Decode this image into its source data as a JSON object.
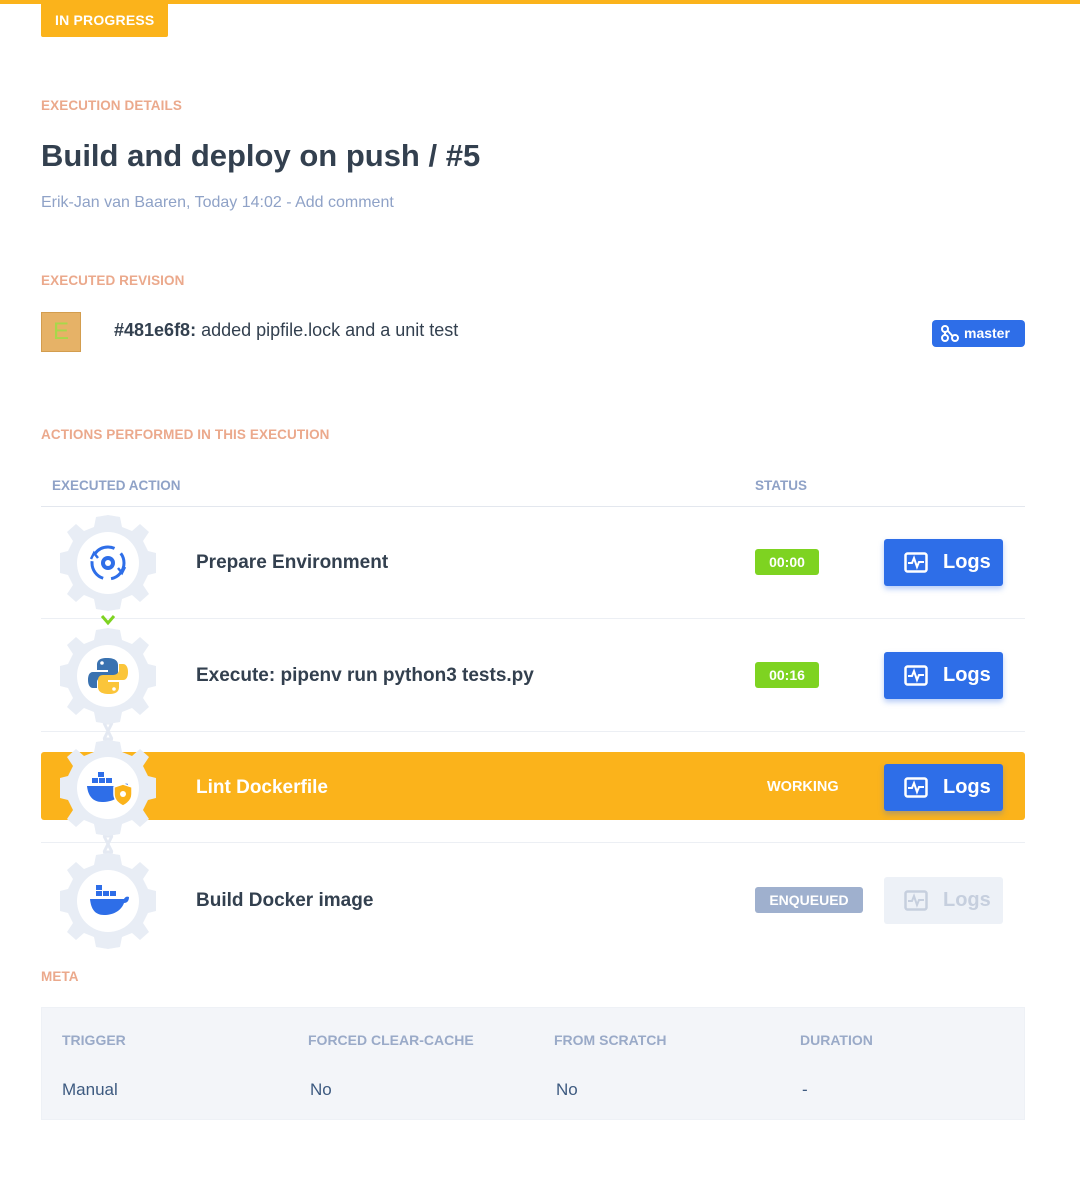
{
  "status_pill": "IN PROGRESS",
  "execution": {
    "section_label": "EXECUTION DETAILS",
    "title": "Build and deploy on push / #5",
    "author_time": "Erik-Jan van Baaren, Today 14:02 - ",
    "add_comment": "Add comment"
  },
  "revision": {
    "section_label": "EXECUTED REVISION",
    "avatar_letter": "E",
    "hash": "#481e6f8:",
    "message": " added pipfile.lock and a unit test",
    "branch": "master"
  },
  "actions": {
    "section_label": "ACTIONS PERFORMED IN THIS EXECUTION",
    "col_action": "EXECUTED ACTION",
    "col_status": "STATUS",
    "logs_label": "Logs",
    "rows": [
      {
        "name": "Prepare Environment",
        "status": "00:00",
        "icon": "gear-refresh-icon"
      },
      {
        "name": "Execute: pipenv run python3 tests.py",
        "status": "00:16",
        "icon": "python-icon"
      },
      {
        "name": "Lint Dockerfile",
        "status": "WORKING",
        "icon": "docker-shield-icon"
      },
      {
        "name": "Build Docker image",
        "status": "ENQUEUED",
        "icon": "docker-icon"
      }
    ]
  },
  "meta": {
    "section_label": "META",
    "headers": [
      "TRIGGER",
      "FORCED CLEAR-CACHE",
      "FROM SCRATCH",
      "DURATION"
    ],
    "values": [
      "Manual",
      "No",
      "No",
      "-"
    ]
  },
  "colors": {
    "accent_orange": "#fbb31b",
    "primary_blue": "#2e6ee8",
    "success_green": "#7ed321",
    "label_salmon": "#eba98c",
    "muted_blue": "#8fa2c7"
  }
}
